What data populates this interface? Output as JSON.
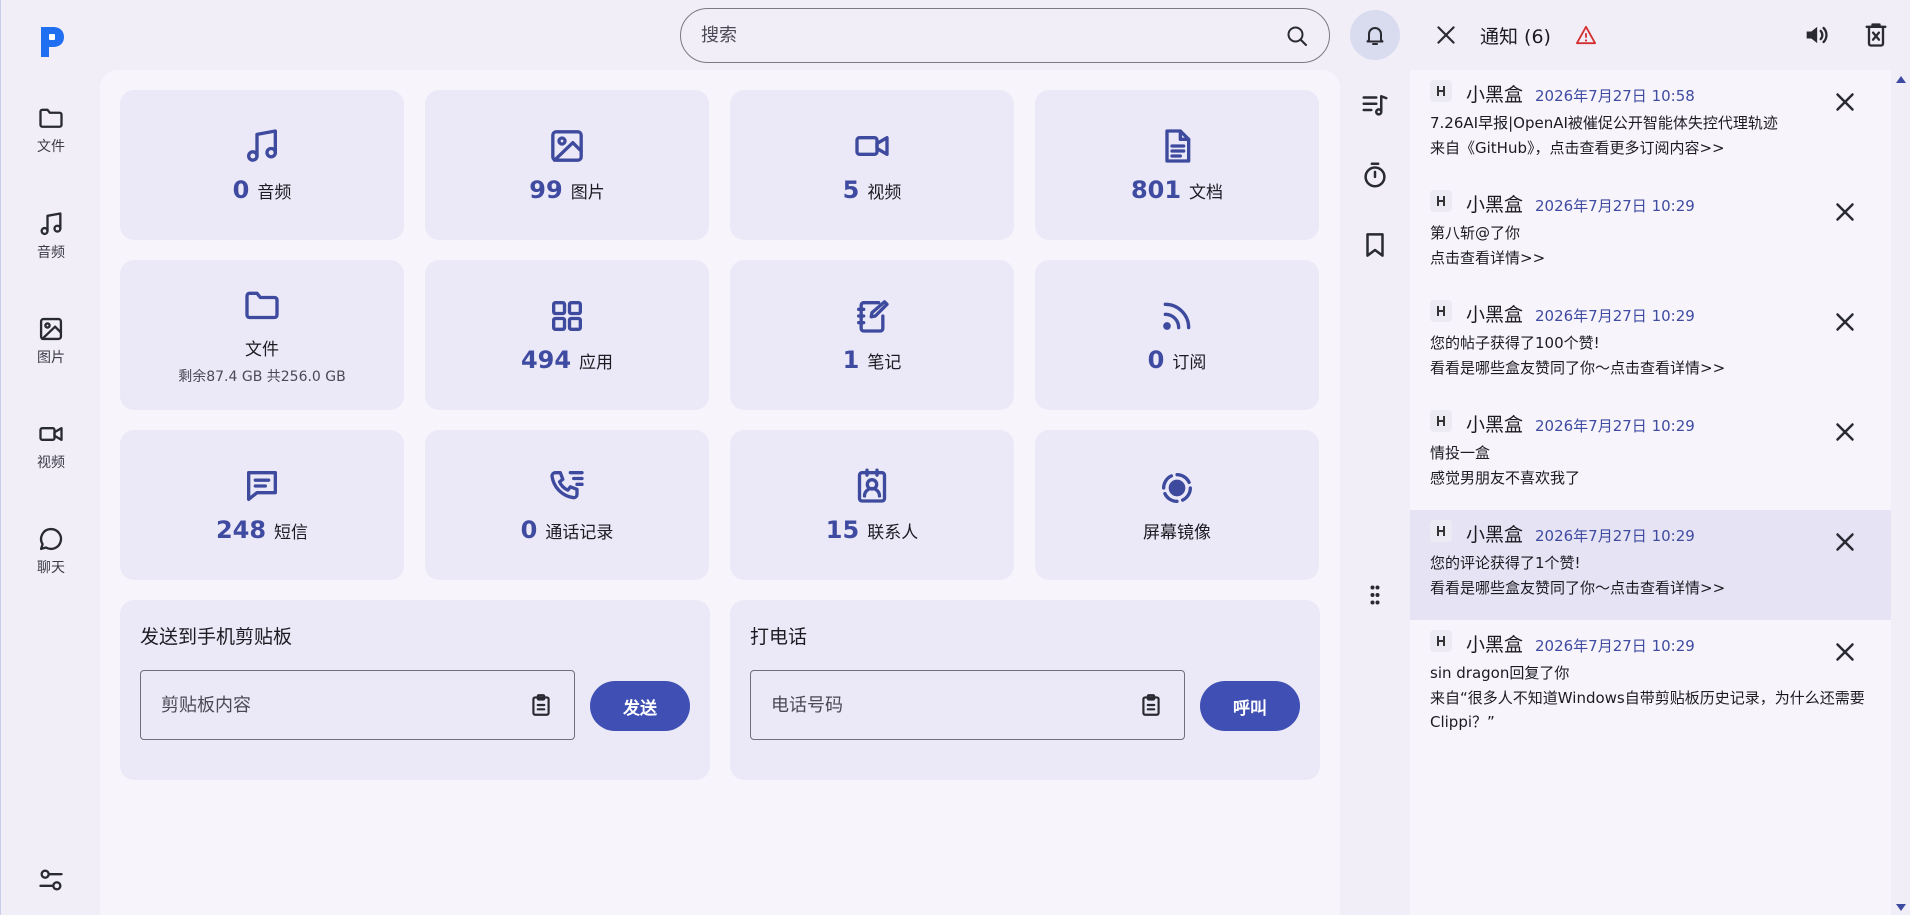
{
  "nav": {
    "items": [
      {
        "label": "文件",
        "icon": "folder-icon"
      },
      {
        "label": "音频",
        "icon": "music-icon"
      },
      {
        "label": "图片",
        "icon": "image-icon"
      },
      {
        "label": "视频",
        "icon": "video-icon"
      },
      {
        "label": "聊天",
        "icon": "chat-icon"
      }
    ]
  },
  "search": {
    "placeholder": "搜索"
  },
  "cards": {
    "audio": {
      "count": "0",
      "label": "音频"
    },
    "images": {
      "count": "99",
      "label": "图片"
    },
    "video": {
      "count": "5",
      "label": "视频"
    },
    "docs": {
      "count": "801",
      "label": "文档"
    },
    "files": {
      "label": "文件",
      "sub": "剩余87.4 GB 共256.0 GB"
    },
    "apps": {
      "count": "494",
      "label": "应用"
    },
    "notes": {
      "count": "1",
      "label": "笔记"
    },
    "feeds": {
      "count": "0",
      "label": "订阅"
    },
    "sms": {
      "count": "248",
      "label": "短信"
    },
    "calls": {
      "count": "0",
      "label": "通话记录"
    },
    "contacts": {
      "count": "15",
      "label": "联系人"
    },
    "mirror": {
      "label": "屏幕镜像"
    }
  },
  "clipboard": {
    "title": "发送到手机剪贴板",
    "placeholder": "剪贴板内容",
    "button": "发送"
  },
  "phone": {
    "title": "打电话",
    "placeholder": "电话号码",
    "button": "呼叫"
  },
  "notifications": {
    "title": "通知 (6)",
    "items": [
      {
        "sender": "小黑盒",
        "time": "2026年7月27日 10:58",
        "line1": "7.26AI早报|OpenAI被催促公开智能体失控代理轨迹",
        "line2": "来自《GitHub》，点击查看更多订阅内容>>"
      },
      {
        "sender": "小黑盒",
        "time": "2026年7月27日 10:29",
        "line1": "第八斩@了你",
        "line2": "点击查看详情>>"
      },
      {
        "sender": "小黑盒",
        "time": "2026年7月27日 10:29",
        "line1": "您的帖子获得了100个赞!",
        "line2": "看看是哪些盒友赞同了你～点击查看详情>>"
      },
      {
        "sender": "小黑盒",
        "time": "2026年7月27日 10:29",
        "line1": "情投一盒",
        "line2": "感觉男朋友不喜欢我了"
      },
      {
        "sender": "小黑盒",
        "time": "2026年7月27日 10:29",
        "line1": "您的评论获得了1个赞!",
        "line2": "看看是哪些盒友赞同了你～点击查看详情>>"
      },
      {
        "sender": "小黑盒",
        "time": "2026年7月27日 10:29",
        "line1": "sin dragon回复了你",
        "line2": "来自“很多人不知道Windows自带剪贴板历史记录，为什么还需要Clippi？”"
      }
    ]
  },
  "colors": {
    "accent": "#3f4fb3",
    "background": "#f1eef8",
    "card": "#ebe9f7",
    "warning": "#d32f2f"
  }
}
